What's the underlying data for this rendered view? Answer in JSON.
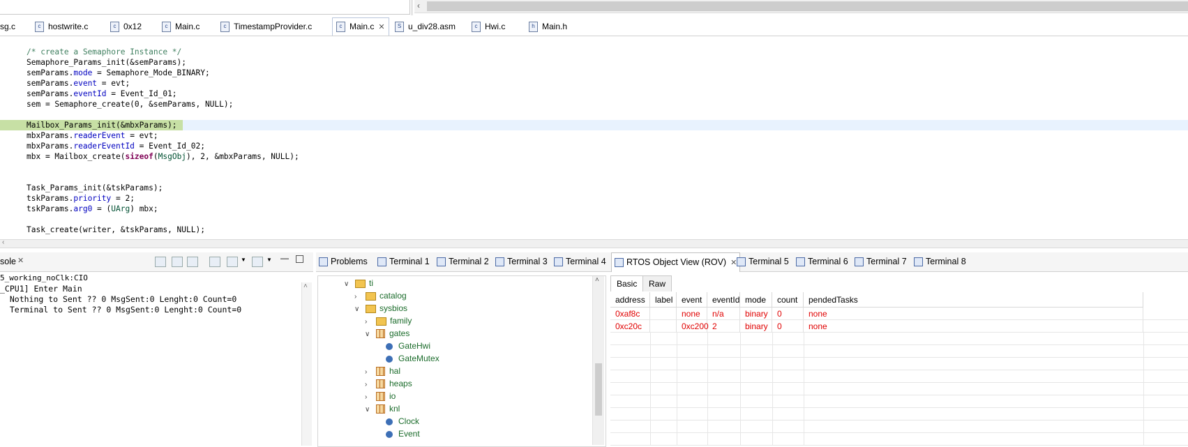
{
  "editor_tabs": [
    {
      "label": "sg.c",
      "icon": "c-file-icon"
    },
    {
      "label": "hostwrite.c",
      "icon": "c-file-icon"
    },
    {
      "label": "0x12",
      "icon": "c-file-icon"
    },
    {
      "label": "Main.c",
      "icon": "c-file-icon"
    },
    {
      "label": "TimestampProvider.c",
      "icon": "c-file-icon"
    },
    {
      "label": "Main.c",
      "icon": "c-file-icon",
      "active": true
    },
    {
      "label": "u_div28.asm",
      "icon": "asm-file-icon"
    },
    {
      "label": "Hwi.c",
      "icon": "c-file-icon"
    },
    {
      "label": "Main.h",
      "icon": "h-file-icon"
    }
  ],
  "code": {
    "lines": [
      "/* create a Semaphore Instance */",
      "Semaphore_Params_init(&semParams);",
      "semParams.mode = Semaphore_Mode_BINARY;",
      "semParams.event = evt;",
      "semParams.eventId = Event_Id_01;",
      "sem = Semaphore_create(0, &semParams, NULL);",
      "",
      "Mailbox_Params_init(&mbxParams);",
      "mbxParams.readerEvent = evt;",
      "mbxParams.readerEventId = Event_Id_02;",
      "mbx = Mailbox_create(sizeof(MsgObj), 2, &mbxParams, NULL);",
      "",
      "",
      "Task_Params_init(&tskParams);",
      "tskParams.priority = 2;",
      "tskParams.arg0 = (UArg) mbx;",
      "",
      "Task_create(writer, &tskParams, NULL);"
    ],
    "highlighted_line": 7
  },
  "console": {
    "tab_label": "sole",
    "subtitle": "5_working_noClk:CIO",
    "lines": [
      "_CPU1] Enter Main",
      "  Nothing to Sent ?? 0 MsgSent:0 Lenght:0 Count=0",
      "  Terminal to Sent ?? 0 MsgSent:0 Lenght:0 Count=0"
    ]
  },
  "view_tabs": [
    {
      "label": "Problems",
      "icon": "problems-icon"
    },
    {
      "label": "Terminal 1",
      "icon": "terminal-icon"
    },
    {
      "label": "Terminal 2",
      "icon": "terminal-icon"
    },
    {
      "label": "Terminal 3",
      "icon": "terminal-icon"
    },
    {
      "label": "Terminal 4",
      "icon": "terminal-icon"
    },
    {
      "label": "RTOS Object View (ROV)",
      "icon": "table-icon",
      "active": true
    },
    {
      "label": "Terminal 5",
      "icon": "terminal-icon"
    },
    {
      "label": "Terminal 6",
      "icon": "terminal-icon"
    },
    {
      "label": "Terminal 7",
      "icon": "terminal-icon"
    },
    {
      "label": "Terminal 8",
      "icon": "terminal-icon"
    }
  ],
  "tree": [
    {
      "label": "ti",
      "depth": 0,
      "type": "folder",
      "state": "expanded"
    },
    {
      "label": "catalog",
      "depth": 1,
      "type": "folder",
      "state": "collapsed"
    },
    {
      "label": "sysbios",
      "depth": 1,
      "type": "folder",
      "state": "expanded"
    },
    {
      "label": "family",
      "depth": 2,
      "type": "folder",
      "state": "collapsed"
    },
    {
      "label": "gates",
      "depth": 2,
      "type": "package",
      "state": "expanded"
    },
    {
      "label": "GateHwi",
      "depth": 3,
      "type": "module",
      "state": "leaf"
    },
    {
      "label": "GateMutex",
      "depth": 3,
      "type": "module",
      "state": "leaf"
    },
    {
      "label": "hal",
      "depth": 2,
      "type": "package",
      "state": "collapsed"
    },
    {
      "label": "heaps",
      "depth": 2,
      "type": "package",
      "state": "collapsed"
    },
    {
      "label": "io",
      "depth": 2,
      "type": "package",
      "state": "collapsed"
    },
    {
      "label": "knl",
      "depth": 2,
      "type": "package",
      "state": "expanded"
    },
    {
      "label": "Clock",
      "depth": 3,
      "type": "module",
      "state": "leaf"
    },
    {
      "label": "Event",
      "depth": 3,
      "type": "module",
      "state": "leaf"
    }
  ],
  "rov": {
    "tabs": [
      "Basic",
      "Raw"
    ],
    "active_tab": "Basic",
    "columns": [
      "address",
      "label",
      "event",
      "eventId",
      "mode",
      "count",
      "pendedTasks"
    ],
    "rows": [
      [
        "0xaf8c",
        "",
        "none",
        "n/a",
        "binary",
        "0",
        "none"
      ],
      [
        "0xc20c",
        "",
        "0xc200",
        "2",
        "binary",
        "0",
        "none"
      ]
    ]
  }
}
